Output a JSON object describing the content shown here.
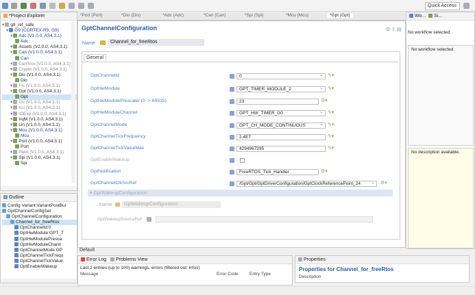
{
  "toolbar": {
    "quick_access": "Quick Access"
  },
  "project_explorer": {
    "title": "*Project Explorer",
    "items": [
      {
        "text": "g9_ref_safe",
        "cls": "",
        "indent": 0,
        "icon": "gr"
      },
      {
        "text": "G9 (CORTEX-R5, G9)",
        "cls": "blue",
        "indent": 1,
        "icon": "b"
      },
      {
        "text": "Adc (V1.0.0, AS4.3.1)",
        "cls": "blue",
        "indent": 2,
        "icon": "g"
      },
      {
        "text": "Adc",
        "cls": "blue",
        "indent": 3,
        "icon": "g"
      },
      {
        "text": "Assets (V1.0.0, AS4.3.1)",
        "cls": "",
        "indent": 2,
        "icon": "g",
        "italic": true
      },
      {
        "text": "Can (V1.0.0, AS4.3.1)",
        "cls": "blue",
        "indent": 2,
        "icon": "g"
      },
      {
        "text": "Can",
        "cls": "blue",
        "indent": 3,
        "icon": "g"
      },
      {
        "text": "CanTrcv (V1.0.0, AS4.3.1)",
        "cls": "gray",
        "indent": 2,
        "icon": "gr"
      },
      {
        "text": "Crypto (V1.0.0, AS4.3.1)",
        "cls": "gray",
        "indent": 2,
        "icon": "gr"
      },
      {
        "text": "Dio (V1.0.0, AS4.3.1)",
        "cls": "",
        "indent": 2,
        "icon": "g"
      },
      {
        "text": "Dio",
        "cls": "",
        "indent": 3,
        "icon": "g"
      },
      {
        "text": "Fls (V1.0.0, AS4.3.1)",
        "cls": "gray",
        "indent": 2,
        "icon": "gr"
      },
      {
        "text": "Gpt (V1.0.0, AS4.3.1)",
        "cls": "",
        "indent": 2,
        "icon": "g"
      },
      {
        "text": "Gpt",
        "cls": "",
        "indent": 3,
        "icon": "g",
        "selected": true
      },
      {
        "text": "I2c (V1.0.0, AS4.3.1)",
        "cls": "gray",
        "indent": 2,
        "icon": "gr"
      },
      {
        "text": "Icu (V1.0.0, AS4.3.1)",
        "cls": "gray",
        "indent": 2,
        "icon": "gr"
      },
      {
        "text": "IOExp (V1.0.0, AS4.3.1)",
        "cls": "gray",
        "indent": 2,
        "icon": "gr"
      },
      {
        "text": "IrqM (V1.0.0, AS4.3.1)",
        "cls": "",
        "indent": 2,
        "icon": "g"
      },
      {
        "text": "Lin (V1.0.0, AS4.3.1)",
        "cls": "",
        "indent": 2,
        "icon": "g"
      },
      {
        "text": "Mcu (V1.0.0, AS4.3.1)",
        "cls": "blue",
        "indent": 2,
        "icon": "g"
      },
      {
        "text": "Mcu",
        "cls": "blue",
        "indent": 3,
        "icon": "g"
      },
      {
        "text": "Port (V1.0.0, AS4.3.1)",
        "cls": "",
        "indent": 2,
        "icon": "g"
      },
      {
        "text": "Port",
        "cls": "",
        "indent": 3,
        "icon": "g"
      },
      {
        "text": "Pwm (V1.0.0, AS4.3.1)",
        "cls": "gray",
        "indent": 2,
        "icon": "gr"
      },
      {
        "text": "Spi (V1.0.0, AS4.3.1)",
        "cls": "",
        "indent": 2,
        "icon": "g"
      },
      {
        "text": "Spi",
        "cls": "",
        "indent": 3,
        "icon": "g"
      }
    ]
  },
  "outline": {
    "title": "Outline",
    "items": [
      {
        "text": "Config Variant:VariantPostBui",
        "indent": 0,
        "icon": "c"
      },
      {
        "text": "GptChannelConfigSet",
        "indent": 0,
        "icon": "c"
      },
      {
        "text": "GptChannelConfiguration",
        "indent": 1,
        "icon": "c"
      },
      {
        "text": "Channel_for_freeRtos",
        "indent": 2,
        "icon": "c",
        "selected": true
      },
      {
        "text": "GptChannelId:0",
        "indent": 3,
        "icon": "b"
      },
      {
        "text": "GptHwModule:GPT_T",
        "indent": 3,
        "icon": "b"
      },
      {
        "text": "GptHwModulePresca",
        "indent": 3,
        "icon": "b"
      },
      {
        "text": "GptHwModuleChann",
        "indent": 3,
        "icon": "b"
      },
      {
        "text": "GptChannelMode:GP",
        "indent": 3,
        "icon": "b"
      },
      {
        "text": "GptChannelTickFrequ",
        "indent": 3,
        "icon": "b"
      },
      {
        "text": "GptChannelTickValue",
        "indent": 3,
        "icon": "b"
      },
      {
        "text": "GptEnableWakeup",
        "indent": 3,
        "icon": "b"
      }
    ]
  },
  "editor": {
    "tabs": [
      "*Port (Port)",
      "*Dio (Dio)",
      "*Adc (Adc)",
      "*Can (Can)",
      "*Spi (Spi)",
      "*Mcu (Mcu)",
      "*Gpt (Gpt)"
    ],
    "heading": "GptChannelConfiguration",
    "name_label": "Name",
    "name_value": "Channel_for_freeRtos",
    "section_tab": "General",
    "rows": [
      {
        "label": "GptChannelId",
        "value": "0",
        "combo": true,
        "action": "✎▾",
        "disabled": false
      },
      {
        "label": "GptHwModule",
        "value": "GPT_TIMER_MODULE_2",
        "combo": true,
        "action": "✎▾",
        "disabled": false
      },
      {
        "label": "GptHwModulePrescaler (0 -> 65535)",
        "value": "23",
        "combo": false,
        "action": "⚙▾",
        "disabled": false
      },
      {
        "label": "GptHwModuleChannel",
        "value": "GPT_HW_TIMER_G0",
        "combo": true,
        "action": "✎▾",
        "disabled": false
      },
      {
        "label": "GptChannelMode",
        "value": "GPT_CH_MODE_CONTINUOUS",
        "combo": true,
        "action": "✎▾",
        "disabled": false
      },
      {
        "label": "GptChannelTickFrequency",
        "value": "2.4E7",
        "combo": false,
        "action": "✎▾",
        "disabled": false
      },
      {
        "label": "GptChannelTickValueMax",
        "value": "4294967295",
        "combo": false,
        "action": "✎▾",
        "disabled": false
      },
      {
        "label": "GptEnableWakeup",
        "value": "",
        "combo": false,
        "action": "",
        "disabled": true,
        "checkbox": true
      },
      {
        "label": "GptNotification",
        "value": "FreeRTOS_Tick_Handler",
        "combo": false,
        "action": "⚙▾",
        "disabled": false
      },
      {
        "label": "GptChannelClkSrcRef",
        "value": "/Gpt/Gpt/GptDriverConfiguration/GptClockReferencePoint_24",
        "combo": true,
        "action": "⚙▾",
        "disabled": false
      }
    ],
    "wakeup_section": "GptWakeupConfiguration",
    "wakeup_name_label": "Name",
    "wakeup_name_value": "GptWakeupConfiguration",
    "wakeup_source_label": "GptWakeupSourceRef",
    "bottom_tab": "Default"
  },
  "workflow": {
    "tab1": "Wo...",
    "tab2": "Si...",
    "status": "No workflow selected.",
    "status_inner": "No workflow selected.",
    "description": "No description available."
  },
  "error_log": {
    "tab1": "Error Log",
    "tab2": "Problems View",
    "summary": "Last 2 entries (up to 100) warnings, errors (filtered out: infos)",
    "col1": "Message",
    "col2": "Error Code",
    "col3": "Entry Type"
  },
  "properties": {
    "tab": "Properties",
    "title": "Properties for Channel_for_freeRtos",
    "sub": "Description"
  }
}
